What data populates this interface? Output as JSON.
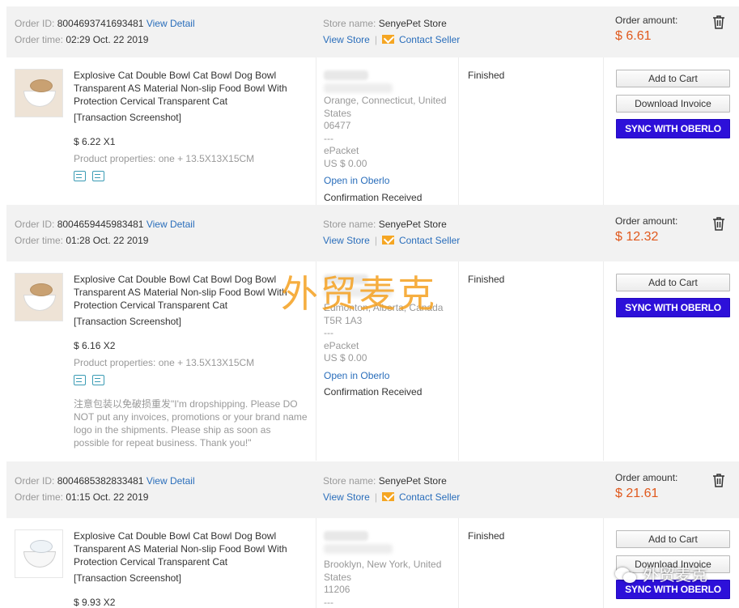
{
  "labels": {
    "order_id": "Order ID:",
    "order_time": "Order time:",
    "view_detail": "View Detail",
    "store_name": "Store name:",
    "view_store": "View Store",
    "separator": "|",
    "contact_seller": "Contact Seller",
    "order_amount": "Order amount:",
    "transaction_screenshot": "[Transaction Screenshot]",
    "product_properties_prefix": "Product properties:",
    "open_in_oberlo": "Open in Oberlo",
    "confirmation_received": "Confirmation Received",
    "add_to_cart": "Add to Cart",
    "download_invoice": "Download Invoice",
    "sync_with_oberlo": "SYNC WITH OBERLO"
  },
  "orders": [
    {
      "order_id": "8004693741693481",
      "order_time": "02:29 Oct. 22 2019",
      "store_name": "SenyePet Store",
      "amount": "$ 6.61",
      "product_title": "Explosive Cat Double Bowl Cat Bowl Dog Bowl Transparent AS Material Non-slip Food Bowl With Protection Cervical Transparent Cat",
      "price_qty": "$ 6.22 X1",
      "properties": "one + 13.5X13X15CM",
      "address_lines": [
        "Orange, Connecticut, United States",
        "06477"
      ],
      "dash": "---",
      "shipping": "ePacket",
      "shipping_cost": "US $ 0.00",
      "status": "Finished"
    },
    {
      "order_id": "8004659445983481",
      "order_time": "01:28 Oct. 22 2019",
      "store_name": "SenyePet Store",
      "amount": "$ 12.32",
      "product_title": "Explosive Cat Double Bowl Cat Bowl Dog Bowl Transparent AS Material Non-slip Food Bowl With Protection Cervical Transparent Cat",
      "price_qty": "$ 6.16 X2",
      "properties": "one + 13.5X13X15CM",
      "address_lines": [
        "Edmonton, Alberta, Canada",
        "T5R 1A3"
      ],
      "dash": "---",
      "shipping": "ePacket",
      "shipping_cost": "US $ 0.00",
      "status": "Finished",
      "note": "注意包装以免破损重发\"I'm dropshipping. Please DO NOT put any invoices, promotions or your brand name logo in the shipments. Please ship as soon as possible for repeat business. Thank you!\""
    },
    {
      "order_id": "8004685382833481",
      "order_time": "01:15 Oct. 22 2019",
      "store_name": "SenyePet Store",
      "amount": "$ 21.61",
      "product_title": "Explosive Cat Double Bowl Cat Bowl Dog Bowl Transparent AS Material Non-slip Food Bowl With Protection Cervical Transparent Cat",
      "price_qty": "$ 9.93 X2",
      "address_lines": [
        "Brooklyn, New York, United States",
        "11206"
      ],
      "dash": "---",
      "status": "Finished"
    }
  ],
  "watermarks": {
    "center": "外贸麦克",
    "corner": "外贸麦克"
  },
  "colors": {
    "amount": "#e0591d",
    "link": "#2a6ebb",
    "sync_button": "#2d10d9",
    "header_bg": "#f2f2f2",
    "watermark": "#f5a01e"
  },
  "icons": [
    "trash-icon",
    "mail-icon",
    "snapshot-icon",
    "invoice-icon"
  ]
}
